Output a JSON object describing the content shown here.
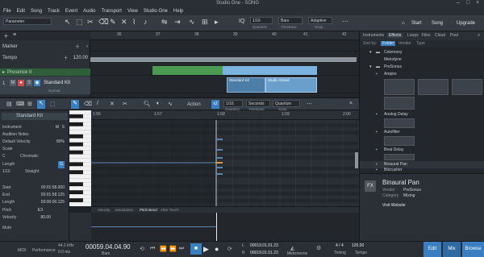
{
  "window": {
    "title": "Studio One - SONG"
  },
  "menu": [
    "File",
    "Edit",
    "Song",
    "Track",
    "Event",
    "Audio",
    "Transport",
    "View",
    "Studio One",
    "Help"
  ],
  "toolbar": {
    "parameter_label": "Parameter",
    "quantize_value": "1/16",
    "quantize_label": "Quantize",
    "timebase_value": "Bars",
    "timebase_label": "Timebase",
    "snap_value": "Adaptive",
    "snap_label": "Snap",
    "iq_label": "IQ",
    "start_label": "Start",
    "song_label": "Song",
    "upgrade_label": "Upgrade"
  },
  "tracks": {
    "marker_label": "Marker",
    "tempo_label": "Tempo",
    "tempo_value": "120.00",
    "folder_label": "Presence II",
    "instrument_track": "Standard Kit",
    "track_number": "1",
    "m": "M",
    "s": "S",
    "normal": "Normal"
  },
  "ruler_bars": [
    "36",
    "37",
    "38",
    "39",
    "40",
    "41",
    "42"
  ],
  "events": {
    "event1": "Standard Kit",
    "event2": "Studio Grand"
  },
  "editor": {
    "quantize_value": "1/16",
    "quantize_label": "Quantize",
    "timebase_value": "Seconds",
    "timebase_label": "Timebase",
    "snap_value": "Quantize",
    "snap_label": "Snap",
    "action_label": "Action",
    "x2_label": "x2",
    "ruler": [
      "1:56",
      "1:57",
      "1:58",
      "1:59",
      "2:00"
    ],
    "tabs": [
      "Velocity",
      "Modulation",
      "Pitch Bend",
      "After Touch"
    ]
  },
  "inspector": {
    "track_name": "Standard Kit",
    "instrument_label": "Instrument",
    "audition_notes": "Audition Notes",
    "default_velocity_label": "Default Velocity",
    "default_velocity_value": "80%",
    "scale_label": "Scale",
    "scale_root": "C",
    "scale_type": "Chromatic",
    "length_label": "Length",
    "length_value": "1/16",
    "length_mode": "Straight",
    "start_label": "Start",
    "start_value": "00:01:58.000",
    "end_label": "End",
    "end_value": "00:01:58.125",
    "length2_label": "Length",
    "length2_value": "00:00:00.125",
    "pitch_label": "Pitch",
    "pitch_value": "E3",
    "velocity_label": "Velocity",
    "velocity_value": "80.00",
    "mute_label": "Mute"
  },
  "browser": {
    "tabs": [
      "Instruments",
      "Effects",
      "Loops",
      "Files",
      "Cloud",
      "Pool"
    ],
    "sort_by": "Sort by:",
    "sort_options": [
      "Folder",
      "Vendor",
      "Type"
    ],
    "items": [
      "Celemony",
      "Melodyne",
      "PreSonus",
      "Ampire",
      "Analog Delay",
      "Autofilter",
      "Beat Delay",
      "Binaural Pan",
      "Bitcrusher"
    ],
    "selected_name": "Binaural Pan",
    "vendor_label": "Vendor",
    "vendor_value": "PreSonus",
    "category_label": "Category",
    "category_value": "Mixing",
    "fx_badge": "FX",
    "visit_label": "Visit Website"
  },
  "transport": {
    "midi_label": "MIDI",
    "performance_label": "Performance",
    "sample_rate": "44.1 kHz",
    "latency": "0.0 ms",
    "position": "00059.04.04.90",
    "position_unit": "Bars",
    "loop_start": "00019.01.01.23",
    "loop_end": "00019.01.01.23",
    "l_label": "L",
    "r_label": "R",
    "metronome_label": "Metronome",
    "signature": "4 / 4",
    "timing_label": "Timing",
    "tempo": "120.00",
    "tempo_label": "Tempo",
    "edit_label": "Edit",
    "mix_label": "Mix",
    "browse_label": "Browse"
  }
}
